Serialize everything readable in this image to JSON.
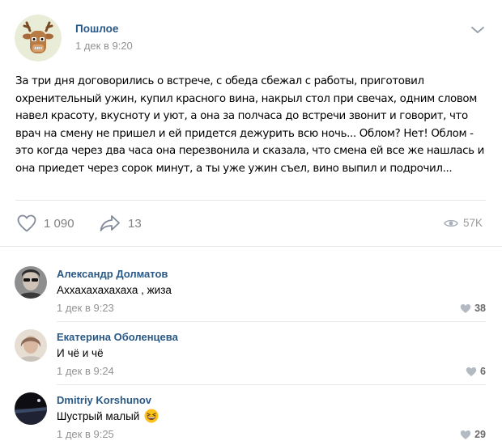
{
  "post": {
    "author": "Пошлое",
    "date": "1 дек в 9:20",
    "text": "За три дня договорились о встрече, с обеда сбежал с работы, приготовил охренительный ужин, купил красного вина, накрыл стол при свечах, одним словом навел красоту, вкусноту и уют, а она за полчаса до встречи звонит и говорит, что врач на смену не пришел и ей придется дежурить всю ночь... Облом? Нет! Облом - это когда через два часа она перезвонила и сказала, что смена ей все же нашлась и она приедет через сорок минут, а ты уже ужин съел, вино выпил и подрочил...",
    "likes": "1 090",
    "shares": "13",
    "views": "57K"
  },
  "comments": [
    {
      "author": "Александр Долматов",
      "text": "Аххахахахахаха , жиза",
      "date": "1 дек в 9:23",
      "likes": "38"
    },
    {
      "author": "Екатерина Оболенцева",
      "text": "И чё и чё",
      "date": "1 дек в 9:24",
      "likes": "6"
    },
    {
      "author": "Dmitriy Korshunov",
      "text": "Шустрый малый",
      "date": "1 дек в 9:25",
      "likes": "29"
    }
  ],
  "icons": {
    "post_avatar": "deer-avatar",
    "menu": "chevron-down-icon",
    "like": "heart-icon",
    "share": "share-arrow-icon",
    "views": "eye-icon",
    "comment_emoji": "laughing-emoji"
  },
  "colors": {
    "link": "#2a5885",
    "meta": "#939393",
    "icon": "#99a2ad"
  }
}
